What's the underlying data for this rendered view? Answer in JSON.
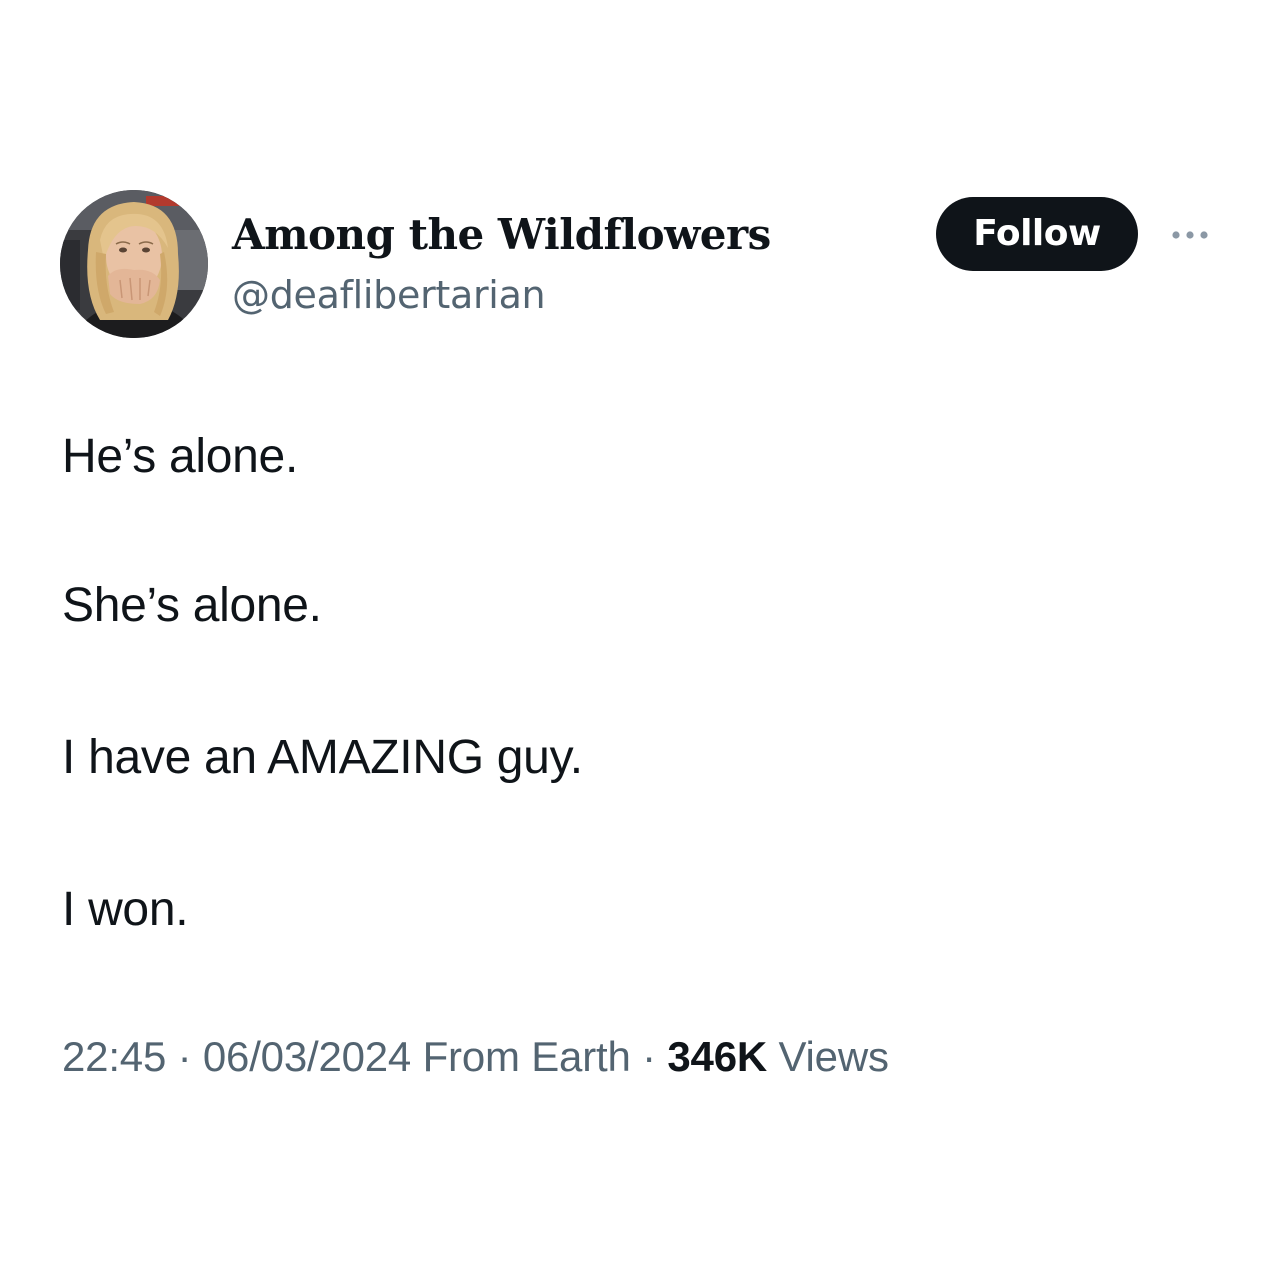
{
  "author": {
    "display_name": "Among the Wildflowers",
    "handle": "@deaflibertarian",
    "avatar_icon": "profile-photo"
  },
  "actions": {
    "follow_label": "Follow",
    "more_icon": "more-horizontal-icon"
  },
  "tweet": {
    "lines": [
      "He’s alone.",
      "She’s alone.",
      "I have an AMAZING guy.",
      "I won."
    ]
  },
  "meta": {
    "time": "22:45",
    "separator": "·",
    "date": "06/03/2024",
    "source": "From Earth",
    "views_count": "346K",
    "views_label": "Views"
  },
  "colors": {
    "text_primary": "#0f1419",
    "text_secondary": "#536471",
    "follow_bg": "#0f1419",
    "follow_text": "#ffffff",
    "background": "#ffffff"
  }
}
